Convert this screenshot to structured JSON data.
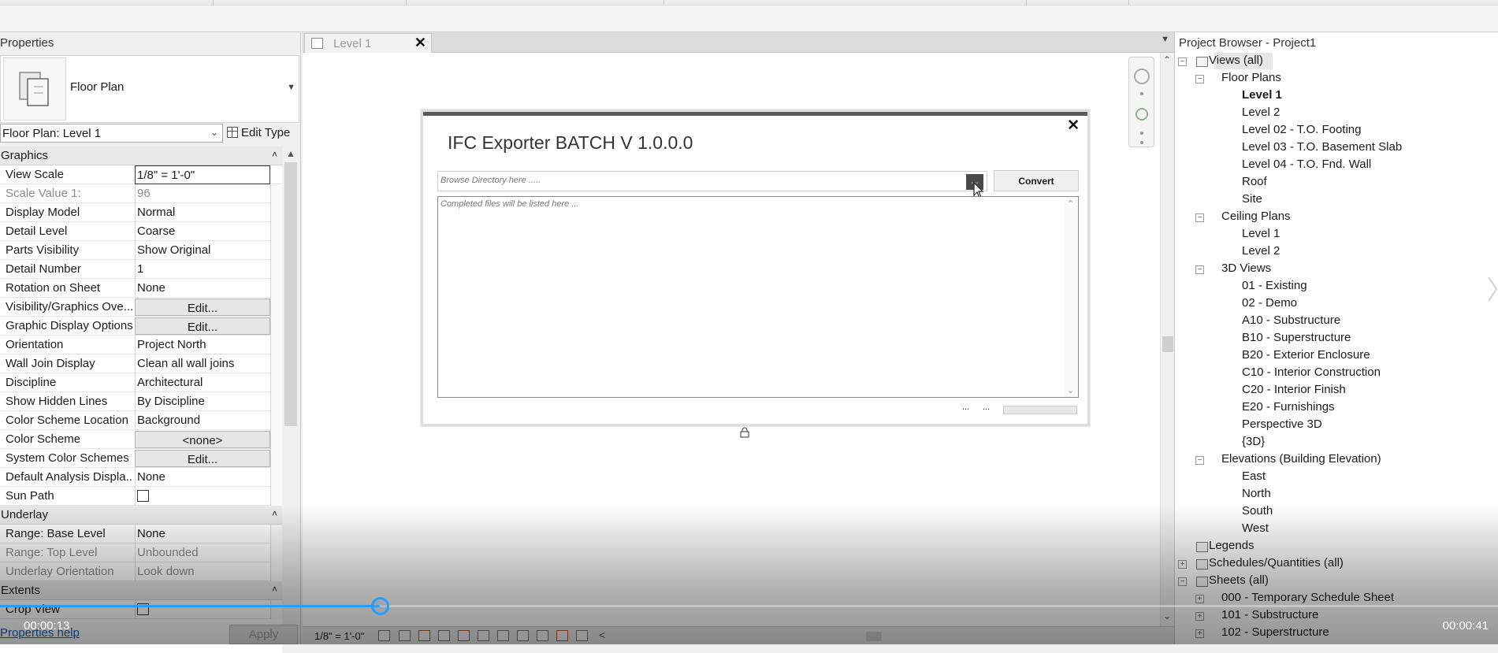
{
  "properties": {
    "title": "Properties",
    "type_name": "Floor Plan",
    "instance": "Floor Plan: Level 1",
    "edit_type": "Edit Type",
    "groups": [
      {
        "label": "Graphics",
        "collapse": "˄"
      },
      {
        "label": "Underlay",
        "collapse": "˄"
      },
      {
        "label": "Extents",
        "collapse": "˄"
      }
    ],
    "rows": [
      {
        "key": "View Scale",
        "value": "1/8\" = 1'-0\""
      },
      {
        "key": "Scale Value    1:",
        "value": "96"
      },
      {
        "key": "Display Model",
        "value": "Normal"
      },
      {
        "key": "Detail Level",
        "value": "Coarse"
      },
      {
        "key": "Parts Visibility",
        "value": "Show Original"
      },
      {
        "key": "Detail Number",
        "value": "1"
      },
      {
        "key": "Rotation on Sheet",
        "value": "None"
      },
      {
        "key": "Visibility/Graphics Ove...",
        "value": "Edit..."
      },
      {
        "key": "Graphic Display Options",
        "value": "Edit..."
      },
      {
        "key": "Orientation",
        "value": "Project North"
      },
      {
        "key": "Wall Join Display",
        "value": "Clean all wall joins"
      },
      {
        "key": "Discipline",
        "value": "Architectural"
      },
      {
        "key": "Show Hidden Lines",
        "value": "By Discipline"
      },
      {
        "key": "Color Scheme Location",
        "value": "Background"
      },
      {
        "key": "Color Scheme",
        "value": "<none>"
      },
      {
        "key": "System Color Schemes",
        "value": "Edit..."
      },
      {
        "key": "Default Analysis Displa...",
        "value": "None"
      },
      {
        "key": "Sun Path",
        "value": ""
      },
      {
        "key": "Range: Base Level",
        "value": "None"
      },
      {
        "key": "Range: Top Level",
        "value": "Unbounded"
      },
      {
        "key": "Underlay Orientation",
        "value": "Look down"
      },
      {
        "key": "Crop View",
        "value": ""
      }
    ],
    "help": "Properties help",
    "apply": "Apply"
  },
  "view_tab": {
    "label": "Level 1",
    "close": "✕",
    "menu": "▼"
  },
  "dialog": {
    "title": "IFC Exporter BATCH V 1.0.0.0",
    "close": "✕",
    "dir_placeholder": "Browse Directory here .....",
    "browse": "...",
    "convert": "Convert",
    "results_placeholder": "Completed files will be listed here ...",
    "status_left": "...",
    "status_right": "..."
  },
  "view_control_bar": {
    "scale": "1/8\" = 1'-0\"",
    "arrow": "<"
  },
  "project_browser": {
    "title": "Project Browser - Project1",
    "views_all": "Views (all)",
    "floor_plans": "Floor Plans",
    "floor_plan_items": [
      "Level 1",
      "Level 2",
      "Level 02 - T.O. Footing",
      "Level 03 - T.O. Basement Slab",
      "Level 04 - T.O. Fnd. Wall",
      "Roof",
      "Site"
    ],
    "ceiling_plans": "Ceiling Plans",
    "ceiling_plan_items": [
      "Level 1",
      "Level 2"
    ],
    "views_3d": "3D Views",
    "views_3d_items": [
      "01 - Existing",
      "02 - Demo",
      "A10 - Substructure",
      "B10 - Superstructure",
      "B20 - Exterior Enclosure",
      "C10 - Interior Construction",
      "C20 - Interior Finish",
      "E20 - Furnishings",
      "Perspective 3D",
      "{3D}"
    ],
    "elevations": "Elevations (Building Elevation)",
    "elevation_items": [
      "East",
      "North",
      "South",
      "West"
    ],
    "legends": "Legends",
    "schedules": "Schedules/Quantities (all)",
    "sheets": "Sheets (all)",
    "sheet_items": [
      "000 - Temporary Schedule Sheet",
      "101 - Substructure",
      "102 - Superstructure"
    ]
  },
  "video": {
    "current_time": "00:00:13",
    "duration": "00:00:41",
    "progress_fraction": 0.317
  },
  "colors": {
    "accent": "#2e9af0",
    "dialog_bar": "#5a5a5a",
    "link": "#1a5fb4"
  }
}
